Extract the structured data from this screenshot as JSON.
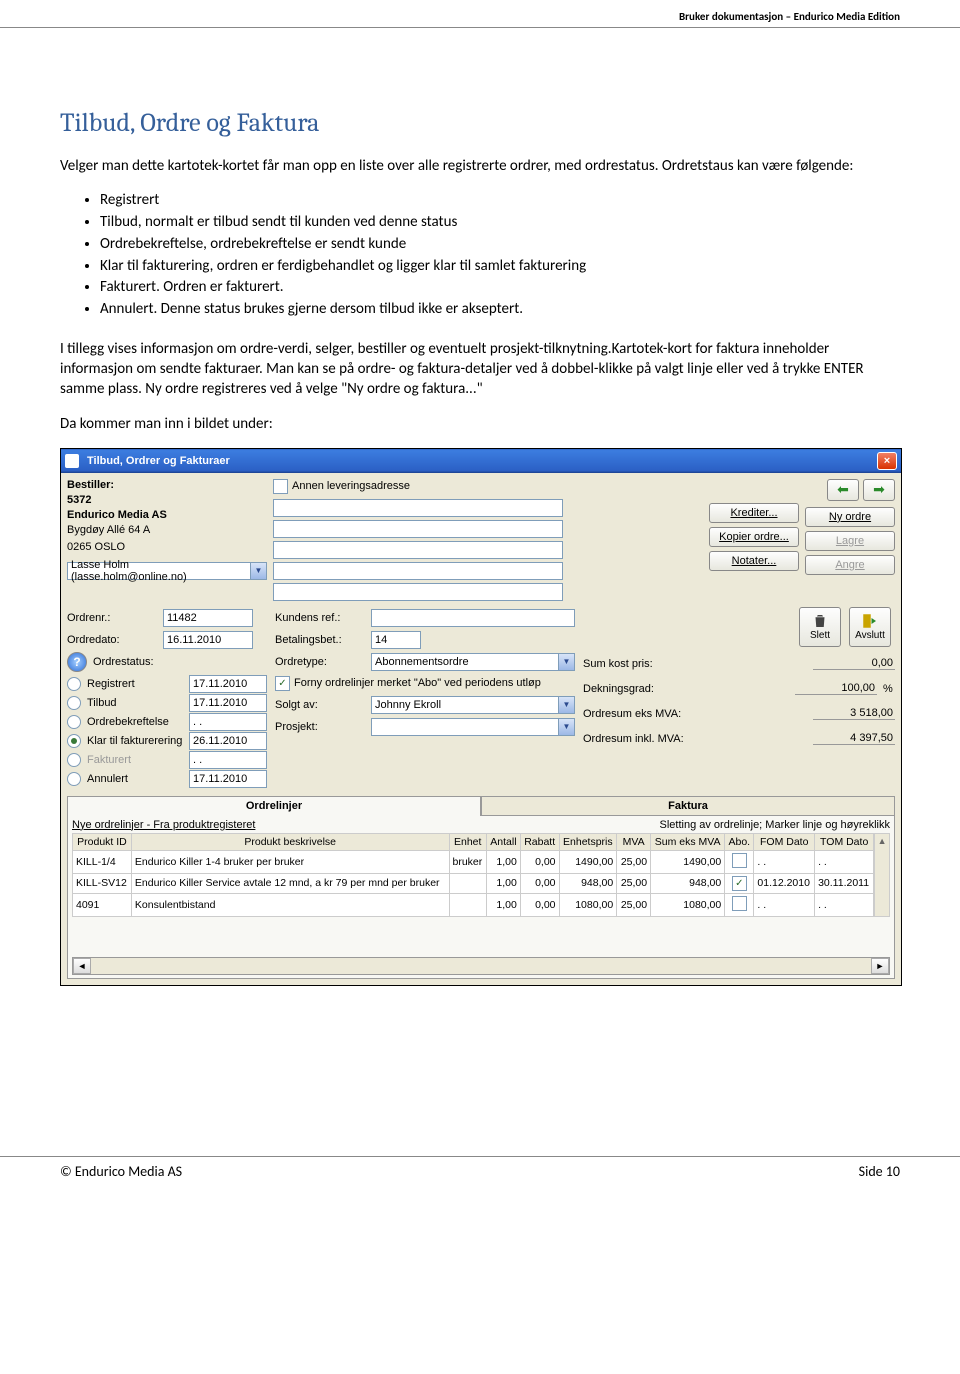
{
  "header": {
    "doc_title": "Bruker dokumentasjon – Endurico Media Edition"
  },
  "h1": "Tilbud, Ordre og Faktura",
  "p1": "Velger man dette kartotek-kortet får man opp en liste over alle registrerte ordrer, med ordrestatus. Ordretstaus kan være følgende:",
  "statuses": [
    "Registrert",
    "Tilbud, normalt er tilbud sendt til kunden ved denne status",
    "Ordrebekreftelse, ordrebekreftelse er sendt kunde",
    "Klar til fakturering, ordren er ferdigbehandlet og ligger klar til samlet fakturering",
    "Fakturert. Ordren er fakturert.",
    "Annulert.  Denne status brukes gjerne dersom tilbud ikke er akseptert."
  ],
  "p2": "I tillegg vises informasjon om ordre-verdi, selger, bestiller og eventuelt prosjekt-tilknytning.Kartotek-kort for faktura inneholder informasjon om sendte fakturaer.  Man kan se på ordre- og faktura-detaljer ved å dobbel-klikke på valgt linje eller ved å trykke ENTER samme plass.  Ny ordre registreres ved å velge  \"Ny ordre og faktura...\"",
  "p3": "Da kommer man inn i bildet under:",
  "ss": {
    "title": "Tilbud, Ordrer og Fakturaer",
    "bestiller_lbl": "Bestiller:",
    "bestiller_id": "5372",
    "bestiller_name": "Endurico Media AS",
    "bestiller_addr1": "Bygdøy Allé 64 A",
    "bestiller_addr2": "0265 OSLO",
    "contact": "Lasse Holm (lasse.holm@online.no)",
    "alt_addr_lbl": "Annen leveringsadresse",
    "ordrenr_lbl": "Ordrenr.:",
    "ordrenr": "11482",
    "ordredato_lbl": "Ordredato:",
    "ordredato": "16.11.2010",
    "kundensref_lbl": "Kundens ref.:",
    "betaling_lbl": "Betalingsbet.:",
    "betaling": "14",
    "ordretype_lbl": "Ordretype:",
    "ordretype": "Abonnementsordre",
    "forny_lbl": "Forny ordrelinjer merket \"Abo\" ved periodens utløp",
    "solgtav_lbl": "Solgt av:",
    "solgtav": "Johnny Ekroll",
    "prosjekt_lbl": "Prosjekt:",
    "ordrestatus_lbl": "Ordrestatus:",
    "status": [
      {
        "label": "Registrert",
        "date": "17.11.2010",
        "on": false,
        "dim": false
      },
      {
        "label": "Tilbud",
        "date": "17.11.2010",
        "on": false,
        "dim": false
      },
      {
        "label": "Ordrebekreftelse",
        "date": ". .",
        "on": false,
        "dim": false
      },
      {
        "label": "Klar til fakturerering",
        "date": "26.11.2010",
        "on": true,
        "dim": false
      },
      {
        "label": "Fakturert",
        "date": ". .",
        "on": false,
        "dim": true
      },
      {
        "label": "Annulert",
        "date": "17.11.2010",
        "on": false,
        "dim": false
      }
    ],
    "btns": {
      "krediter": "Krediter...",
      "kopier": "Kopier ordre...",
      "notater": "Notater...",
      "nyordre": "Ny ordre",
      "lagre": "Lagre",
      "angre": "Angre",
      "slett": "Slett",
      "avslutt": "Avslutt"
    },
    "summary": {
      "kost_lbl": "Sum kost pris:",
      "kost": "0,00",
      "dekn_lbl": "Dekningsgrad:",
      "dekn": "100,00",
      "dekn_sfx": "%",
      "eks_lbl": "Ordresum eks MVA:",
      "eks": "3 518,00",
      "inkl_lbl": "Ordresum inkl. MVA:",
      "inkl": "4 397,50"
    },
    "tabs": {
      "ordrelinjer": "Ordrelinjer",
      "faktura": "Faktura"
    },
    "hint_left": "Nye ordrelinjer - Fra produktregisteret",
    "hint_right": "Sletting av ordrelinje; Marker linje og høyreklikk",
    "cols": [
      "Produkt ID",
      "Produkt beskrivelse",
      "Enhet",
      "Antall",
      "Rabatt",
      "Enhetspris",
      "MVA",
      "Sum eks MVA",
      "Abo.",
      "FOM Dato",
      "TOM Dato"
    ],
    "rows": [
      {
        "id": "KILL-1/4",
        "besk": "Endurico Killer 1-4 bruker per bruker",
        "enhet": "bruker",
        "antall": "1,00",
        "rabatt": "0,00",
        "pris": "1490,00",
        "mva": "25,00",
        "sum": "1490,00",
        "abo": false,
        "fom": ". .",
        "tom": ". ."
      },
      {
        "id": "KILL-SV12",
        "besk": "Endurico Killer Service avtale 12 mnd, a kr 79 per mnd per bruker",
        "enhet": "",
        "antall": "1,00",
        "rabatt": "0,00",
        "pris": "948,00",
        "mva": "25,00",
        "sum": "948,00",
        "abo": true,
        "fom": "01.12.2010",
        "tom": "30.11.2011"
      },
      {
        "id": "4091",
        "besk": "Konsulentbistand",
        "enhet": "",
        "antall": "1,00",
        "rabatt": "0,00",
        "pris": "1080,00",
        "mva": "25,00",
        "sum": "1080,00",
        "abo": false,
        "fom": ". .",
        "tom": ". ."
      }
    ]
  },
  "footer": {
    "left": "© Endurico Media AS",
    "right": "Side 10"
  }
}
